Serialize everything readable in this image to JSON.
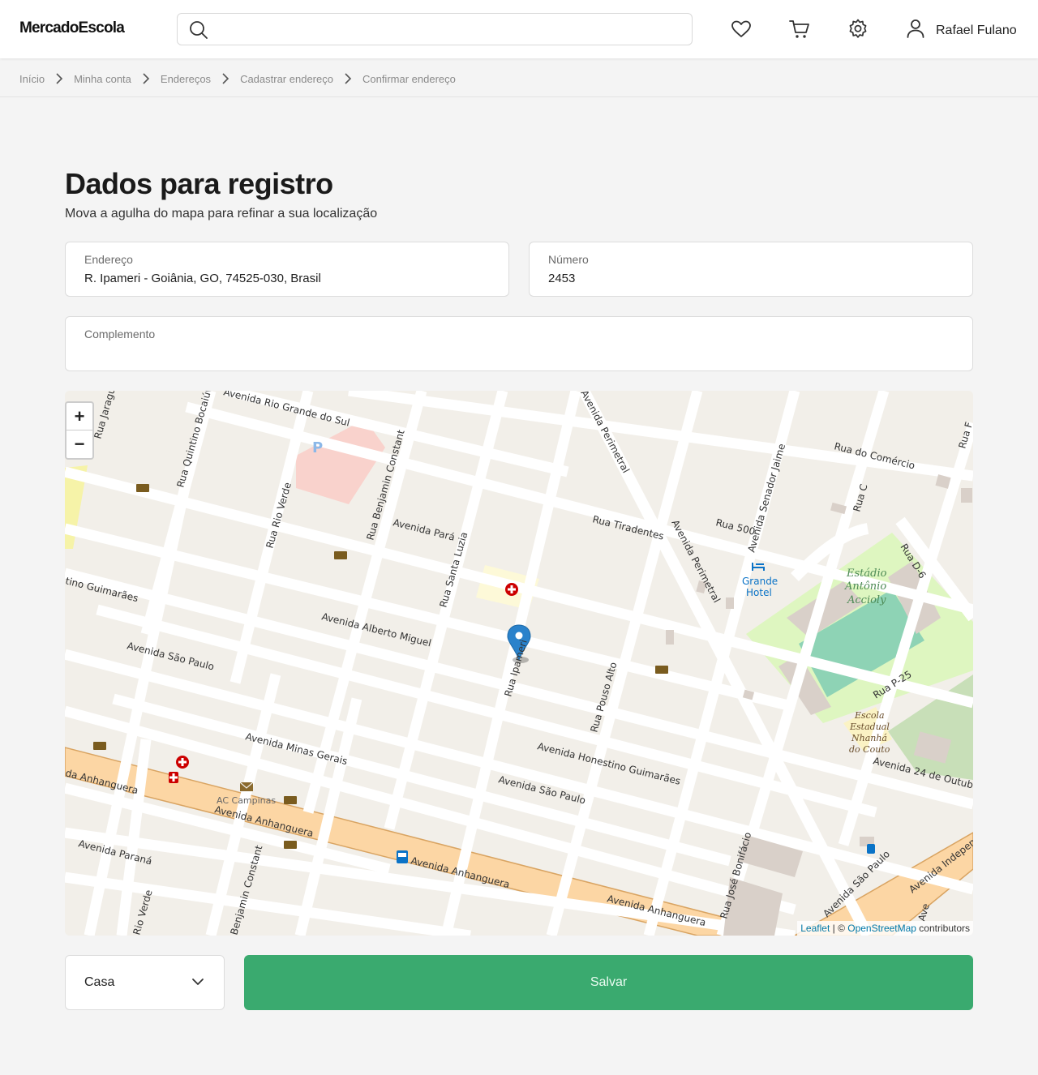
{
  "header": {
    "logo": "MercadoEscola",
    "search": {
      "value": "",
      "placeholder": ""
    },
    "user_name": "Rafael Fulano",
    "icons": [
      "search-icon",
      "heart-icon",
      "cart-icon",
      "gear-icon",
      "user-icon"
    ]
  },
  "breadcrumb": {
    "items": [
      "Início",
      "Minha conta",
      "Endereços",
      "Cadastrar endereço",
      "Confirmar endereço"
    ]
  },
  "page": {
    "title": "Dados para registro",
    "subtitle": "Mova a agulha do mapa para refinar a sua localização"
  },
  "form": {
    "address": {
      "label": "Endereço",
      "value": "R. Ipameri - Goiânia, GO, 74525-030, Brasil"
    },
    "number": {
      "label": "Número",
      "value": "2453"
    },
    "complement": {
      "label": "Complemento",
      "value": ""
    },
    "address_type": {
      "selected": "Casa"
    },
    "save_label": "Salvar"
  },
  "map": {
    "zoom_in": "+",
    "zoom_out": "−",
    "attribution": {
      "leaflet": "Leaflet",
      "sep": " | © ",
      "osm": "OpenStreetMap",
      "suffix": " contributors"
    },
    "streets": {
      "s1": "Avenida Rio Grande do Sul",
      "s2": "Rua Jaraguá",
      "s3": "Rua Quintino Bocaiúva",
      "s4": "Rua Benjamin Constant",
      "s5": "Avenida Perimetral",
      "s6": "Rua do Comércio",
      "s7": "Rua F",
      "s8": "Rua Rio Verde",
      "s9": "Avenida Pará",
      "s10": "Rua Tiradentes",
      "s11": "Rua 500",
      "s12": "Avenida Senador Jaime",
      "s13": "Rua C",
      "s14": "Rua D-6",
      "s15": "Rua Santa Luzia",
      "s16": "Avenida Perimetral",
      "s17": "tino Guimarães",
      "s18": "Avenida Alberto Miguel",
      "s19": "Avenida São Paulo",
      "s20": "Rua Ipameri",
      "s21": "Rua Pouso Alto",
      "s22": "Rua P-25",
      "s23": "Avenida Minas Gerais",
      "s24": "Avenida Honestino Guimarães",
      "s25": "Avenida 24 de Outubro",
      "s26": "da Anhanguera",
      "s27": "Avenida São Paulo",
      "s28": "Avenida Anhanguera",
      "s29": "Avenida Paraná",
      "s30": "Avenida Anhanguera",
      "s31": "Rua José Bonifácio",
      "s32": "Avenida São Paulo",
      "s33": "Avenida Independência",
      "s34": "Avenida Anhanguera",
      "s35": "Rio Verde",
      "s36": "Benjamin Constant",
      "s37": "Ave"
    },
    "pois": {
      "hotel": [
        "Grande",
        "Hotel"
      ],
      "stadium": [
        "Estádio",
        "Antônio",
        "Accioly"
      ],
      "school": [
        "Escola",
        "Estadual",
        "Nhanhá",
        "do Couto"
      ],
      "post": "AC Campinas",
      "parking": "P"
    }
  }
}
